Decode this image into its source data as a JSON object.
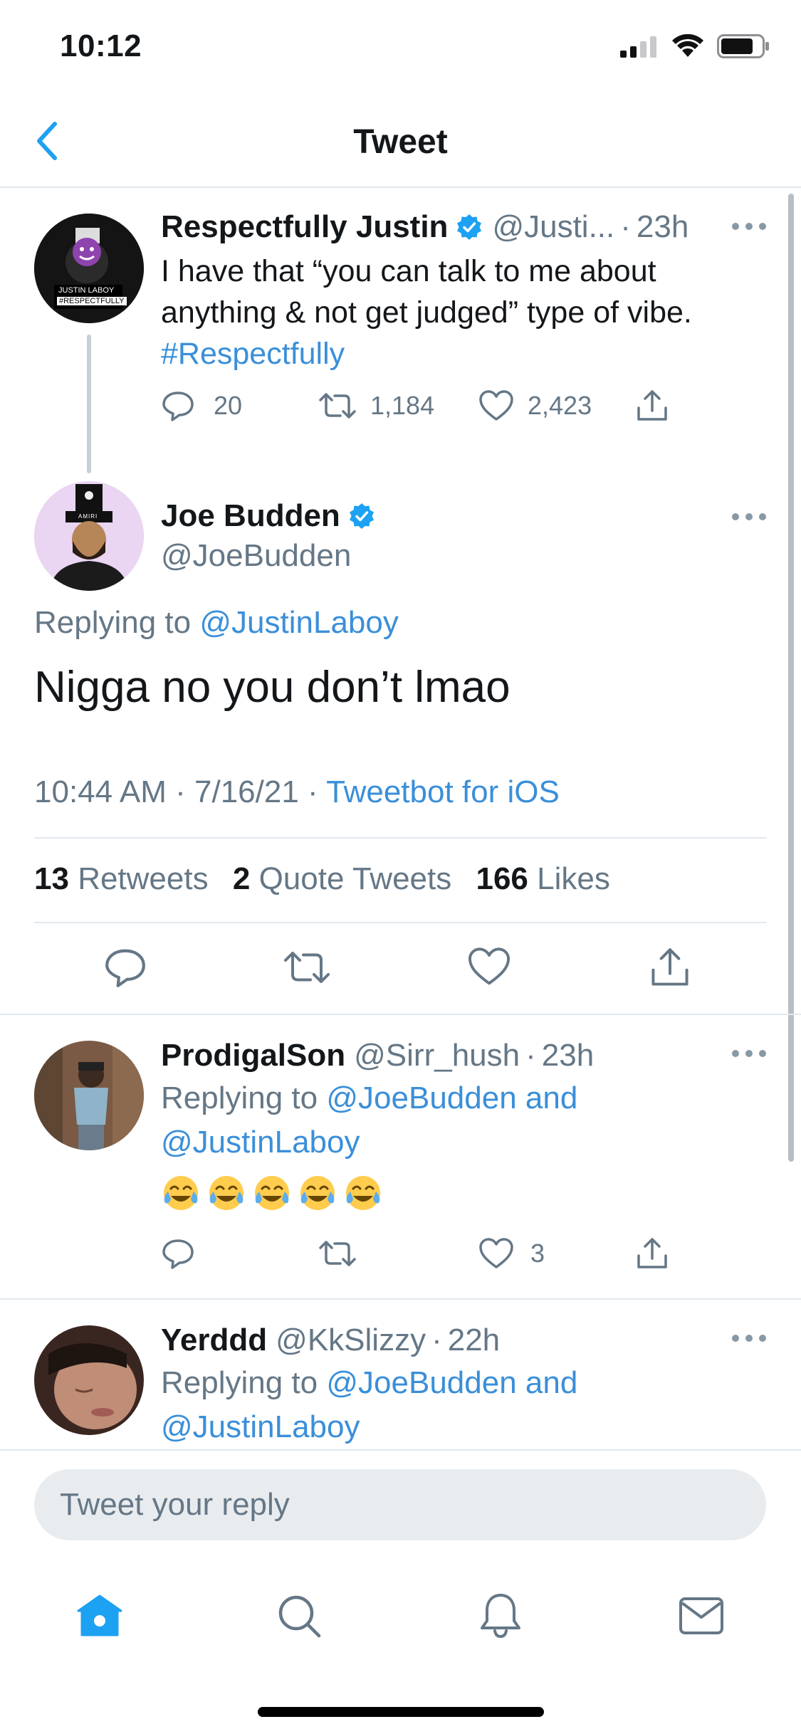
{
  "status_bar": {
    "time": "10:12"
  },
  "nav": {
    "title": "Tweet"
  },
  "parent_tweet": {
    "name": "Respectfully Justin",
    "handle": "@Justi...",
    "time": "23h",
    "text_plain_1": "I have that “you can talk to me about",
    "text_plain_2": "anything & not get judged” type of vibe.",
    "hashtag": "#Respectfully",
    "replies": "20",
    "retweets": "1,184",
    "likes": "2,423",
    "avatar_caption": "JUSTIN LABOY",
    "avatar_tag": "#RESPECTFULLY"
  },
  "main_tweet": {
    "name": "Joe Budden",
    "handle": "@JoeBudden",
    "replying_prefix": "Replying to",
    "replying_to": "@JustinLaboy",
    "text": "Nigga no you don’t lmao",
    "timestamp": "10:44 AM · 7/16/21 ·",
    "client": "Tweetbot for iOS",
    "retweets_count": "13",
    "retweets_label": "Retweets",
    "quotes_count": "2",
    "quotes_label": "Quote Tweets",
    "likes_count": "166",
    "likes_label": "Likes",
    "avatar_caption": "AMIRI"
  },
  "replies": [
    {
      "name": "ProdigalSon",
      "handle": "@Sirr_hush",
      "time": "23h",
      "replying_prefix": "Replying to",
      "replying_to_1": "@JoeBudden and",
      "replying_to_2": "@JustinLaboy",
      "emoji_count": 5,
      "likes": "3"
    },
    {
      "name": "Yerddd",
      "handle": "@KkSlizzy",
      "time": "22h",
      "replying_prefix": "Replying to",
      "replying_to_1": "@JoeBudden and",
      "replying_to_2": "@JustinLaboy"
    }
  ],
  "reply_box": {
    "placeholder": "Tweet your reply"
  },
  "colors": {
    "accent": "#1da1f2",
    "link": "#3a8fd9",
    "text": "#14171a",
    "muted": "#657786",
    "divider": "#e1e8ed"
  },
  "icons": [
    "back-chevron-icon",
    "verified-badge-icon",
    "more-icon",
    "reply-icon",
    "retweet-icon",
    "like-icon",
    "share-icon",
    "home-icon",
    "search-icon",
    "notifications-icon",
    "messages-icon"
  ]
}
